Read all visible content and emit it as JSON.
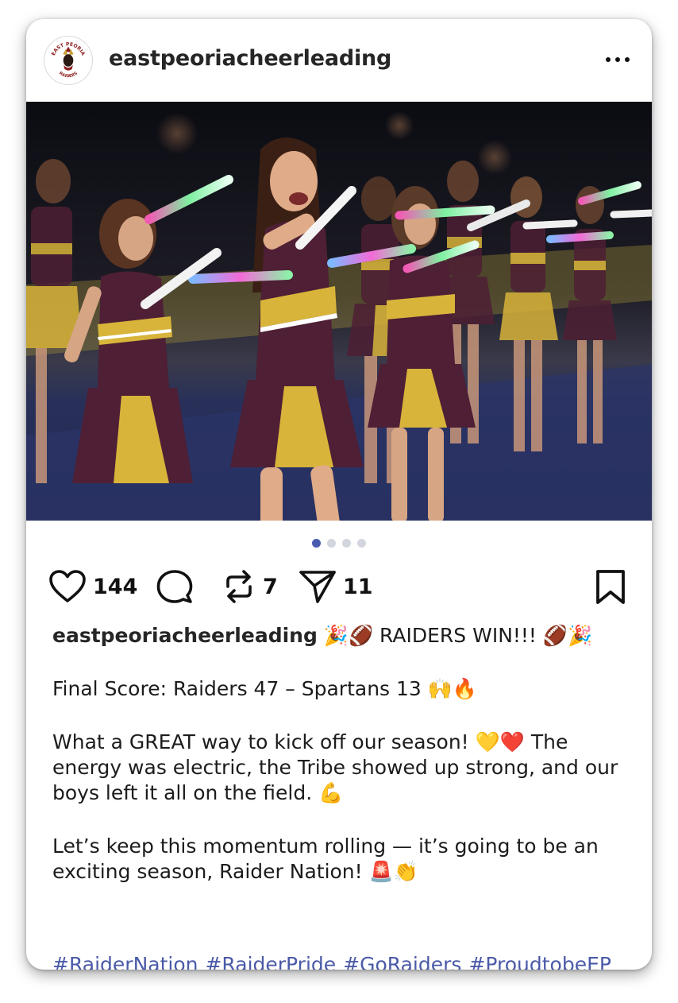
{
  "post": {
    "username": "eastpeoriacheerleading",
    "avatar_text_top": "EAST PEORIA",
    "avatar_text_bottom": "RAIDERS",
    "menu_icon": "more-horizontal-icon"
  },
  "carousel": {
    "total": 4,
    "active_index": 0
  },
  "actions": {
    "likes": "144",
    "reposts": "7",
    "shares": "11",
    "icons": [
      "heart-icon",
      "comment-icon",
      "repost-icon",
      "send-icon",
      "bookmark-icon"
    ]
  },
  "caption": {
    "username": "eastpeoriacheerleading",
    "line1": "🎉🏈 RAIDERS WIN!!! 🏈🎉",
    "para2": "Final Score: Raiders 47 – Spartans 13 🙌🔥",
    "para3": "What a GREAT way to kick off our season! 💛❤️ The energy was electric, the Tribe showed up strong, and our boys left it all on the field. 💪",
    "para4": "Let’s keep this momentum rolling — it’s going to be an exciting season, Raider Nation! 🚨👏",
    "hashtags": [
      "#RaiderNation",
      "#RaiderPride",
      "#GoRaiders",
      "#ProudtobeEP"
    ]
  },
  "colors": {
    "hashtag": "#4a5aa8",
    "dot_active": "#4a5cb0",
    "dot_inactive": "#d3d6de",
    "uniform_maroon": "#4e1f35",
    "uniform_gold": "#d8b43a"
  }
}
